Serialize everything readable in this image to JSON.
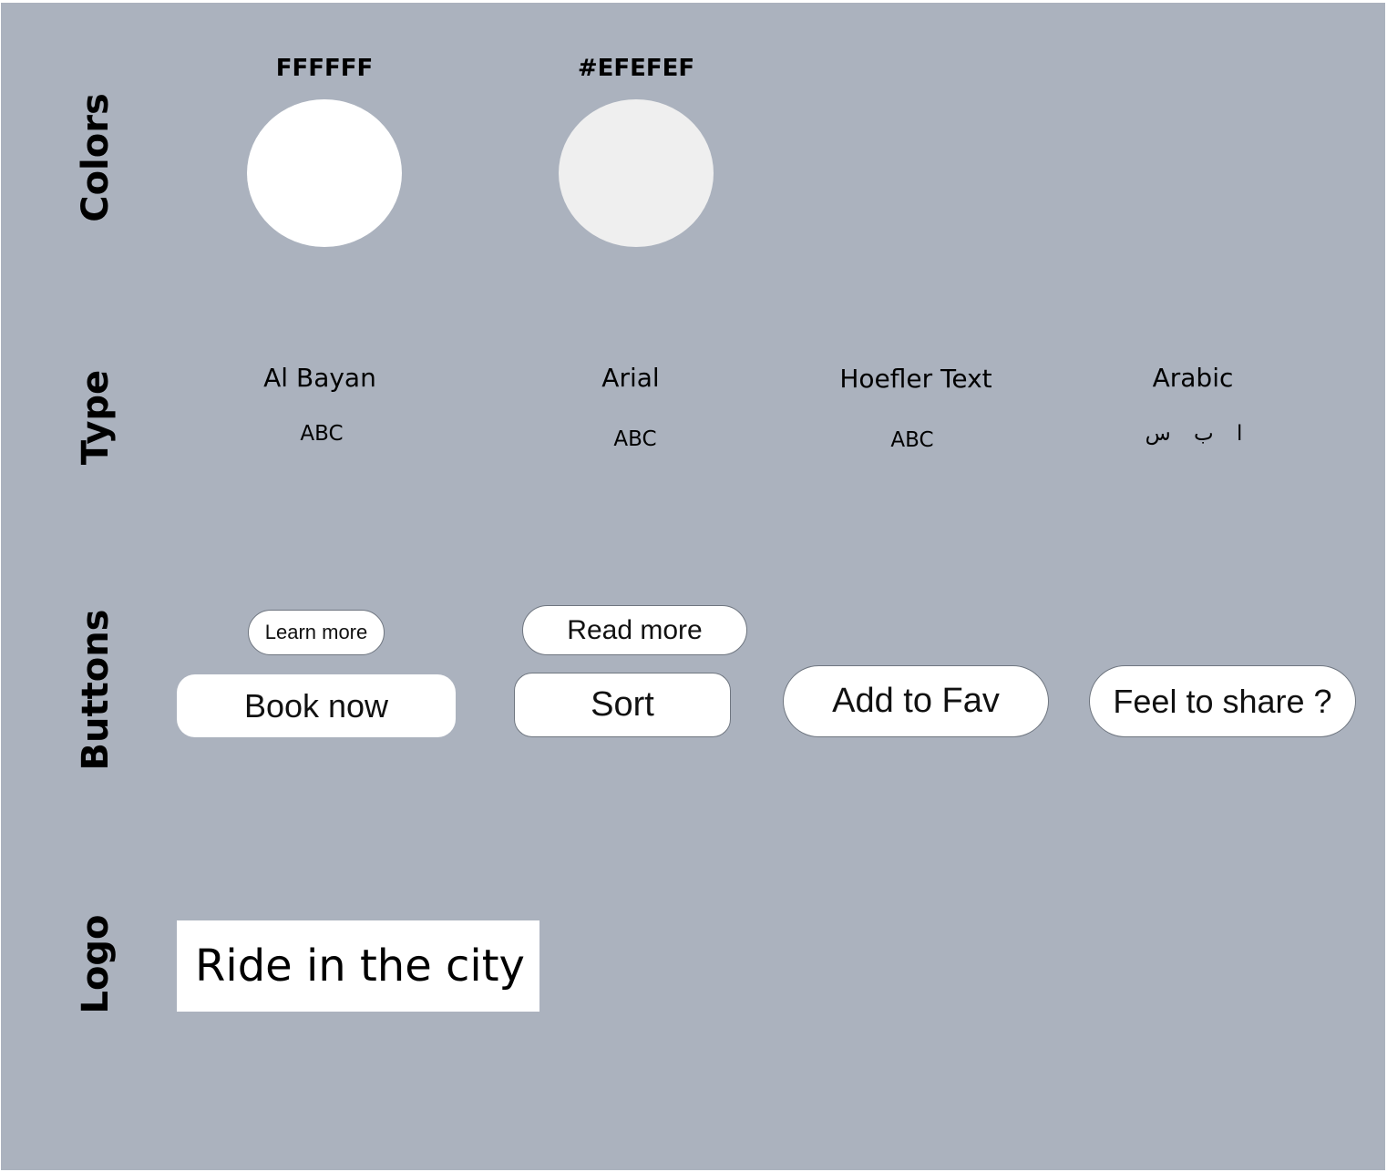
{
  "sections": {
    "colors": "Colors",
    "type": "Type",
    "buttons": "Buttons",
    "logo": "Logo"
  },
  "colors": [
    {
      "label": "FFFFFF",
      "hex": "#FFFFFF"
    },
    {
      "label": "#EFEFEF",
      "hex": "#EFEFEF"
    }
  ],
  "typefaces": [
    {
      "name": "Al Bayan",
      "sample": "ABC"
    },
    {
      "name": "Arial",
      "sample": "ABC"
    },
    {
      "name": "Hoefler Text",
      "sample": "ABC"
    },
    {
      "name": "Arabic",
      "sample": "ا ب س"
    }
  ],
  "buttons": {
    "learn_more": "Learn more",
    "read_more": "Read more",
    "book_now": "Book now",
    "sort": "Sort",
    "add_to_fav": "Add to Fav",
    "feel_to_share": "Feel to share ?"
  },
  "logo": {
    "text": "Ride in the city"
  },
  "theme": {
    "board_background": "#ABB2BE",
    "button_background": "#FFFFFF",
    "button_border": "#6F7680"
  }
}
